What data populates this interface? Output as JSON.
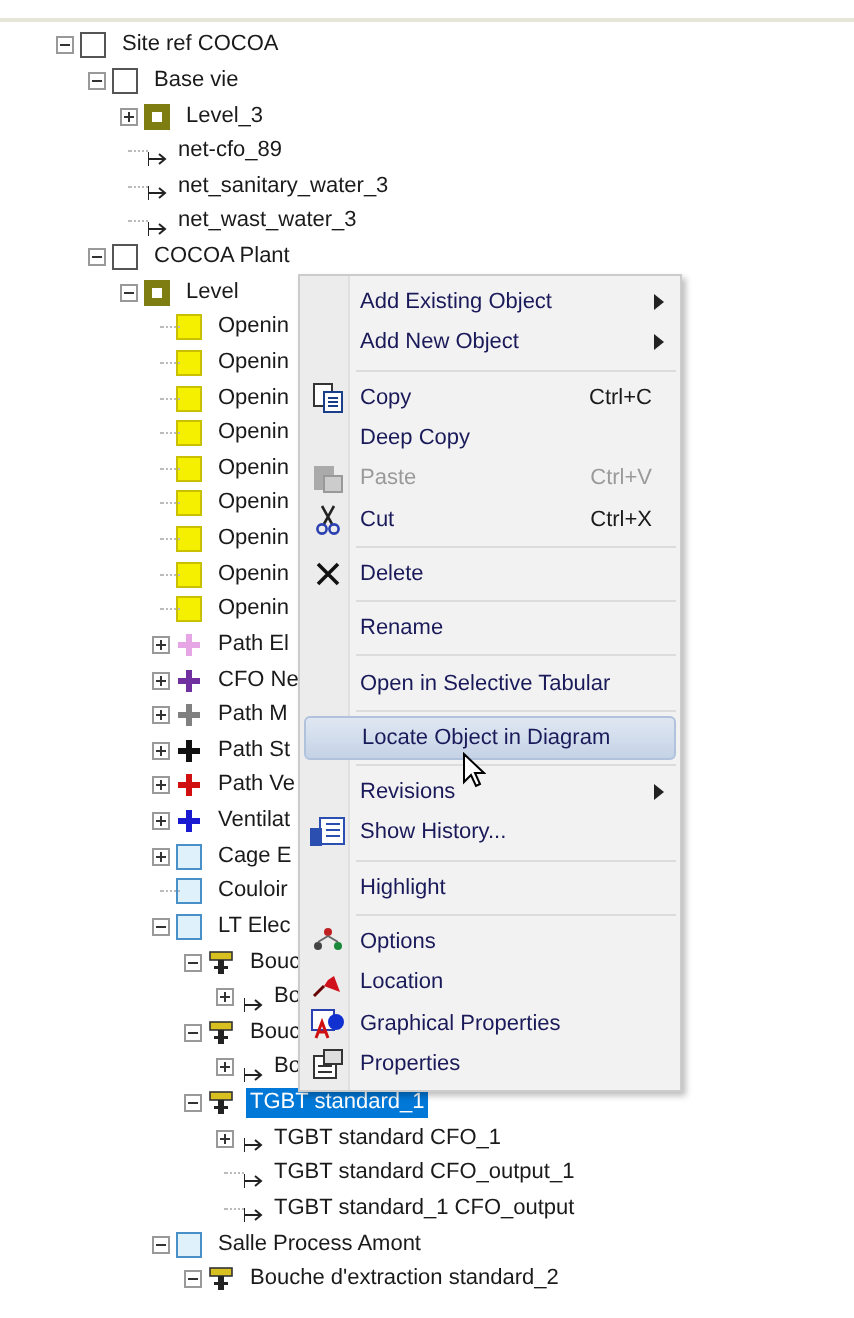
{
  "tree": {
    "label": "Site ref COCOA",
    "kind": "checkbox",
    "expanded": true,
    "selected": false,
    "children": [
      {
        "label": "Base vie",
        "kind": "checkbox",
        "expanded": true,
        "selected": false,
        "children": [
          {
            "label": "Level_3",
            "kind": "level",
            "expanded": false,
            "selected": false
          },
          {
            "label": "net-cfo_89",
            "kind": "net",
            "selected": false
          },
          {
            "label": "net_sanitary_water_3",
            "kind": "net",
            "selected": false
          },
          {
            "label": "net_wast_water_3",
            "kind": "net",
            "selected": false
          }
        ]
      },
      {
        "label": "COCOA Plant",
        "kind": "checkbox",
        "expanded": true,
        "selected": false,
        "children": [
          {
            "label": "Level",
            "kind": "level",
            "expanded": true,
            "selected": false,
            "children": [
              {
                "label": "Openin",
                "kind": "opening",
                "selected": false
              },
              {
                "label": "Openin",
                "kind": "opening",
                "selected": false
              },
              {
                "label": "Openin",
                "kind": "opening",
                "selected": false
              },
              {
                "label": "Openin",
                "kind": "opening",
                "selected": false
              },
              {
                "label": "Openin",
                "kind": "opening",
                "selected": false
              },
              {
                "label": "Openin",
                "kind": "opening",
                "selected": false
              },
              {
                "label": "Openin",
                "kind": "opening",
                "selected": false
              },
              {
                "label": "Openin",
                "kind": "opening",
                "selected": false
              },
              {
                "label": "Openin",
                "kind": "opening",
                "selected": false
              },
              {
                "label": "Path El",
                "kind": "path",
                "color": "#e6a6e6",
                "expanded": false,
                "selected": false
              },
              {
                "label": "CFO Ne",
                "kind": "path",
                "color": "#7030a0",
                "expanded": false,
                "selected": false
              },
              {
                "label": "Path M",
                "kind": "path",
                "color": "#808080",
                "expanded": false,
                "selected": false
              },
              {
                "label": "Path St",
                "kind": "path",
                "color": "#111111",
                "expanded": false,
                "selected": false
              },
              {
                "label": "Path Ve",
                "kind": "path",
                "color": "#d01010",
                "expanded": false,
                "selected": false
              },
              {
                "label": "Ventilat",
                "kind": "path",
                "color": "#1a1ad0",
                "expanded": false,
                "selected": false
              },
              {
                "label": "Cage E",
                "kind": "room",
                "expanded": false,
                "selected": false
              },
              {
                "label": "Couloir",
                "kind": "room",
                "selected": false
              },
              {
                "label": "LT Elec",
                "kind": "room",
                "expanded": true,
                "selected": false,
                "children": [
                  {
                    "label": "Bouc",
                    "kind": "terminal",
                    "expanded": true,
                    "selected": false,
                    "children": [
                      {
                        "label": "Bo",
                        "kind": "net",
                        "expanded": false,
                        "selected": false
                      }
                    ]
                  },
                  {
                    "label": "Bouc",
                    "kind": "terminal",
                    "expanded": true,
                    "selected": false,
                    "children": [
                      {
                        "label": "Bo",
                        "kind": "net",
                        "expanded": false,
                        "selected": false
                      }
                    ]
                  },
                  {
                    "label": "TGBT standard_1",
                    "kind": "terminal",
                    "expanded": true,
                    "selected": true,
                    "children": [
                      {
                        "label": "TGBT standard CFO_1",
                        "kind": "net",
                        "expanded": false,
                        "selected": false
                      },
                      {
                        "label": "TGBT standard CFO_output_1",
                        "kind": "net",
                        "selected": false
                      },
                      {
                        "label": "TGBT standard_1 CFO_output",
                        "kind": "net",
                        "selected": false
                      }
                    ]
                  }
                ]
              },
              {
                "label": "Salle Process Amont",
                "kind": "room",
                "expanded": true,
                "selected": false,
                "children": [
                  {
                    "label": "Bouche d'extraction standard_2",
                    "kind": "terminal",
                    "expanded": true,
                    "selected": false
                  }
                ]
              }
            ]
          }
        ]
      }
    ]
  },
  "context_menu": [
    {
      "kind": "item",
      "label": "Add Existing Object",
      "submenu": true,
      "disabled": false,
      "highlighted": false
    },
    {
      "kind": "item",
      "label": "Add New Object",
      "submenu": true,
      "disabled": false,
      "highlighted": false
    },
    {
      "kind": "separator"
    },
    {
      "kind": "item",
      "label": "Copy",
      "shortcut": "Ctrl+C",
      "disabled": false,
      "highlighted": false
    },
    {
      "kind": "item",
      "label": "Deep Copy",
      "disabled": false,
      "highlighted": false
    },
    {
      "kind": "item",
      "label": "Paste",
      "shortcut": "Ctrl+V",
      "disabled": true,
      "highlighted": false
    },
    {
      "kind": "item",
      "label": "Cut",
      "shortcut": "Ctrl+X",
      "disabled": false,
      "highlighted": false
    },
    {
      "kind": "separator"
    },
    {
      "kind": "item",
      "label": "Delete",
      "disabled": false,
      "highlighted": false
    },
    {
      "kind": "separator"
    },
    {
      "kind": "item",
      "label": "Rename",
      "disabled": false,
      "highlighted": false
    },
    {
      "kind": "separator"
    },
    {
      "kind": "item",
      "label": "Open in Selective Tabular",
      "disabled": false,
      "highlighted": false
    },
    {
      "kind": "separator"
    },
    {
      "kind": "item",
      "label": "Locate Object in Diagram",
      "disabled": false,
      "highlighted": true
    },
    {
      "kind": "separator"
    },
    {
      "kind": "item",
      "label": "Revisions",
      "submenu": true,
      "disabled": false,
      "highlighted": false
    },
    {
      "kind": "item",
      "label": "Show History...",
      "disabled": false,
      "highlighted": false
    },
    {
      "kind": "separator"
    },
    {
      "kind": "item",
      "label": "Highlight",
      "disabled": false,
      "highlighted": false
    },
    {
      "kind": "separator"
    },
    {
      "kind": "item",
      "label": "Options",
      "disabled": false,
      "highlighted": false
    },
    {
      "kind": "item",
      "label": "Location",
      "disabled": false,
      "highlighted": false
    },
    {
      "kind": "item",
      "label": "Graphical Properties",
      "disabled": false,
      "highlighted": false
    },
    {
      "kind": "item",
      "label": "Properties",
      "disabled": false,
      "highlighted": false
    }
  ]
}
